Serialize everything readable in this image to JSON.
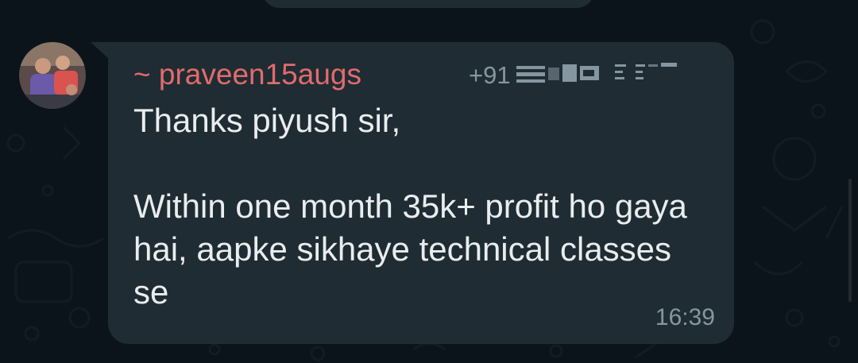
{
  "chat": {
    "message": {
      "sender": "~ praveen15augs",
      "phone": "+91",
      "text": "Thanks piyush sir,\n\nWithin one month 35k+ profit ho gaya hai, aapke sikhaye technical classes se",
      "time": "16:39"
    }
  },
  "colors": {
    "background": "#0b141a",
    "bubble": "#1f2c34",
    "sender_name": "#e26b6b",
    "message_text": "#e9edef",
    "meta_text": "#8696a0"
  }
}
